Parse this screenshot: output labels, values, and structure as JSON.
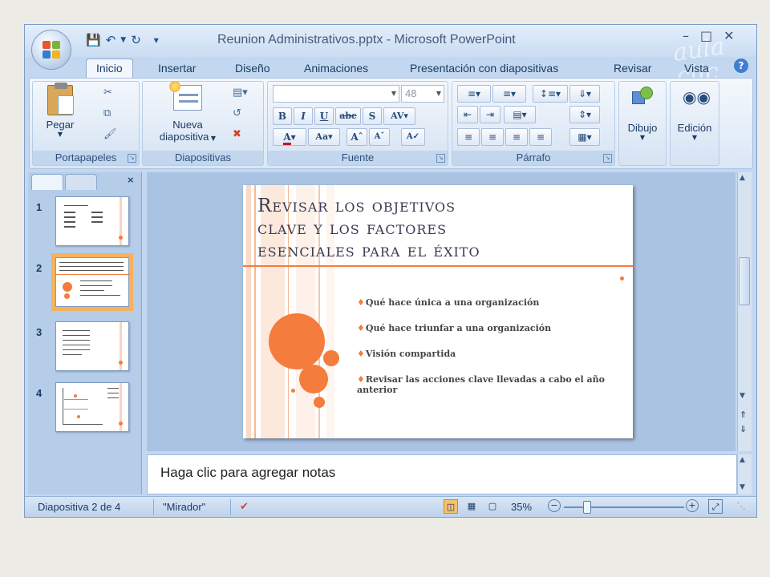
{
  "window": {
    "title": "Reunion Administrativos.pptx - Microsoft PowerPoint",
    "watermark": "aula clic"
  },
  "quick_access": {
    "icons": [
      "save-icon",
      "undo-icon",
      "redo-icon",
      "customize-icon"
    ]
  },
  "ribbon": {
    "tabs": [
      {
        "label": "Inicio",
        "active": true
      },
      {
        "label": "Insertar"
      },
      {
        "label": "Diseño"
      },
      {
        "label": "Animaciones"
      },
      {
        "label": "Presentación con diapositivas"
      },
      {
        "label": "Revisar"
      },
      {
        "label": "Vista"
      }
    ],
    "clipboard": {
      "paste_label": "Pegar",
      "group_label": "Portapapeles"
    },
    "slides": {
      "new_slide_label_1": "Nueva",
      "new_slide_label_2": "diapositiva",
      "group_label": "Diapositivas"
    },
    "font": {
      "size_value": "48",
      "group_label": "Fuente"
    },
    "paragraph": {
      "group_label": "Párrafo"
    },
    "drawing": {
      "label": "Dibujo"
    },
    "editing": {
      "label": "Edición"
    }
  },
  "slide_panel": {
    "thumbnails": [
      {
        "number": "1",
        "selected": false
      },
      {
        "number": "2",
        "selected": true
      },
      {
        "number": "3",
        "selected": false
      },
      {
        "number": "4",
        "selected": false
      }
    ]
  },
  "slide": {
    "title": "Revisar los objetivos\nclave y los factores\nesenciales para el éxito",
    "bullets": [
      "Qué hace única a una organización",
      "Qué hace triunfar  a una organización",
      "Visión compartida",
      "Revisar las acciones clave llevadas a cabo el año anterior"
    ],
    "accent_color": "#F47C3C"
  },
  "notes": {
    "placeholder": "Haga clic para agregar notas"
  },
  "status_bar": {
    "slide_info": "Diapositiva 2 de 4",
    "theme": "\"Mirador\"",
    "zoom": "35%"
  },
  "colors": {
    "ribbon_blue": "#C3D8F0",
    "selection_orange": "#F5B25A",
    "accent": "#F47C3C"
  }
}
